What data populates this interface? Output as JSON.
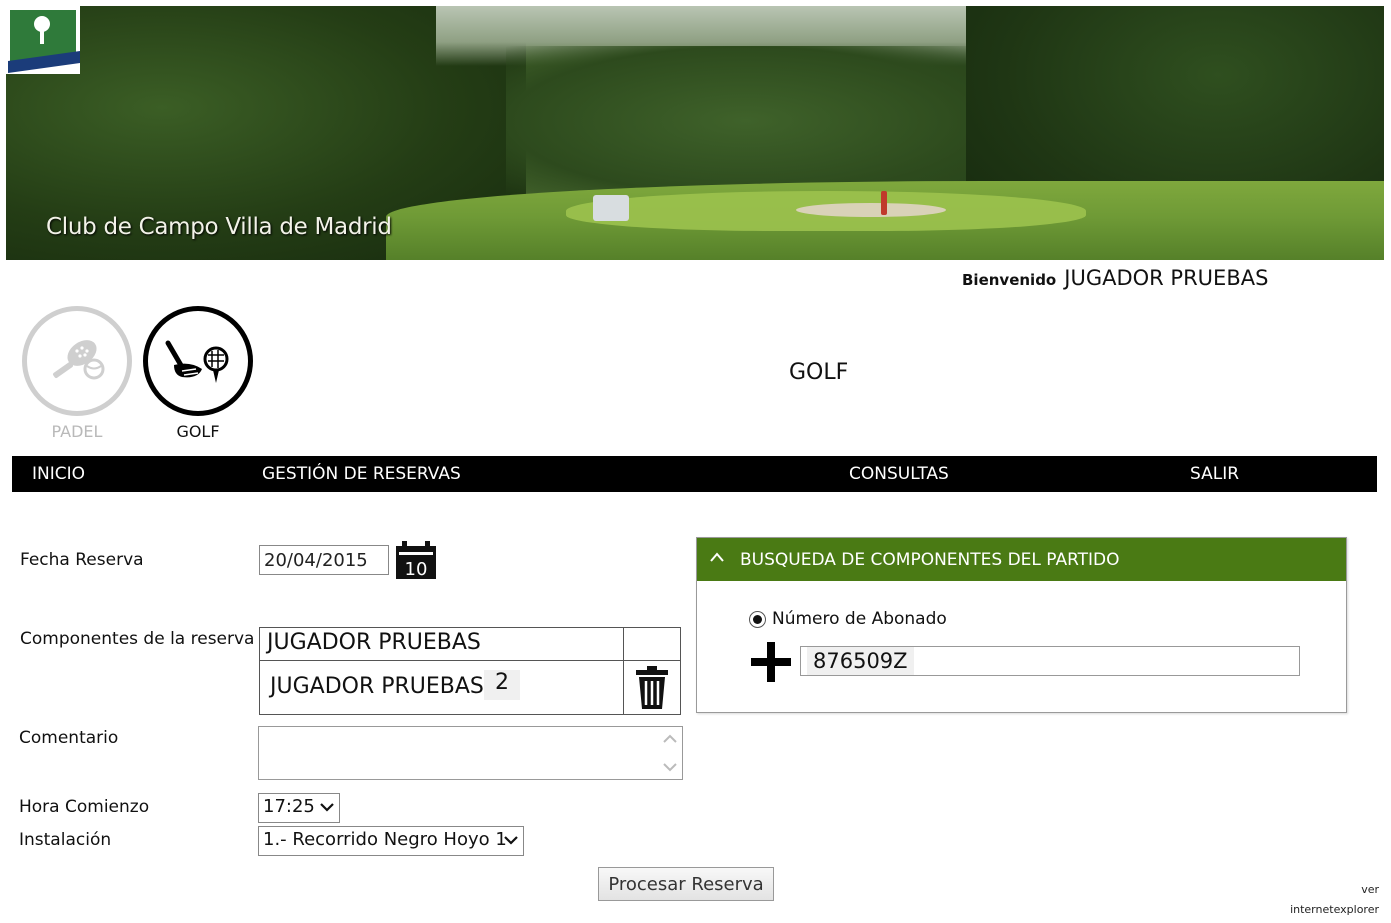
{
  "header": {
    "title": "Club de Campo Villa de Madrid",
    "welcome_label": "Bienvenido",
    "user_name": "JUGADOR PRUEBAS"
  },
  "sports": [
    {
      "label": "PADEL",
      "icon": "padel-racket-icon",
      "active": false
    },
    {
      "label": "GOLF",
      "icon": "golf-club-icon",
      "active": true
    }
  ],
  "section_title": "GOLF",
  "nav": {
    "items": [
      "INICIO",
      "GESTIÓN DE RESERVAS",
      "CONSULTAS",
      "SALIR"
    ]
  },
  "form": {
    "fecha_label": "Fecha Reserva",
    "fecha_value": "20/04/2015",
    "calendar_day": "10",
    "componentes_label": "Componentes de la reserva",
    "componentes": [
      {
        "name": "JUGADOR PRUEBAS"
      },
      {
        "name": "JUGADOR PRUEBAS",
        "number": "2"
      }
    ],
    "comentario_label": "Comentario",
    "comentario_value": "",
    "hora_label": "Hora Comienzo",
    "hora_value": "17:25",
    "instalacion_label": "Instalación",
    "instalacion_value": "1.- Recorrido Negro Hoyo 1",
    "submit_label": "Procesar Reserva"
  },
  "search_panel": {
    "title": "BUSQUEDA DE COMPONENTES DEL PARTIDO",
    "radio_label": "Número de Abonado",
    "abonado_value": "876509Z"
  },
  "footer": {
    "line1": "ver",
    "line2": "internetexplorer"
  },
  "colors": {
    "nav_bg": "#000000",
    "panel_header": "#4a7a14"
  }
}
